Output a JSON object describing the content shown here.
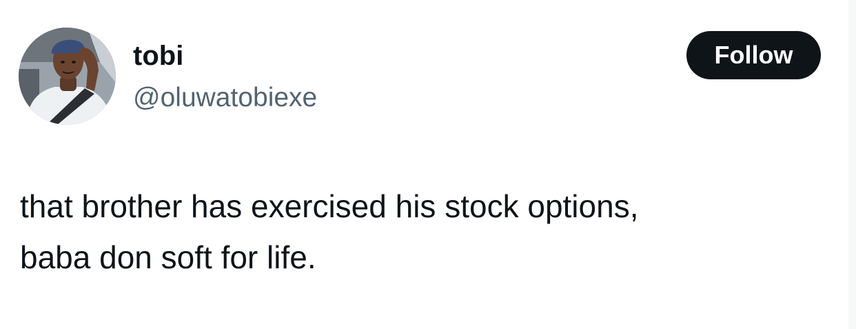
{
  "author": {
    "display_name": "tobi",
    "handle": "@oluwatobiexe",
    "avatar_icon": "user-photo-avatar"
  },
  "actions": {
    "follow_label": "Follow"
  },
  "tweet": {
    "lines": [
      "that brother has exercised his stock options,",
      "baba don soft for life."
    ]
  },
  "colors": {
    "text_primary": "#0f1419",
    "text_secondary": "#536471",
    "button_bg": "#0f1419",
    "button_text": "#ffffff"
  }
}
